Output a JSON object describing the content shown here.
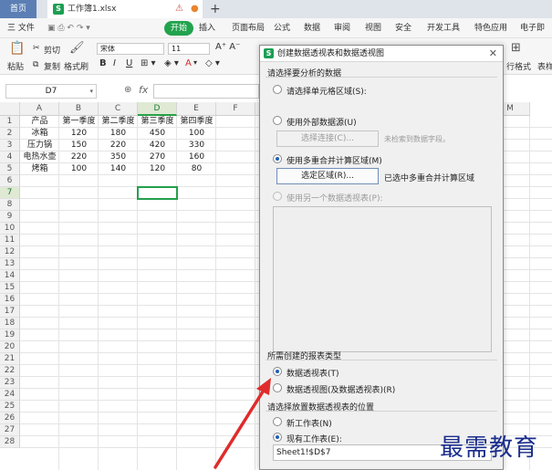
{
  "tabs": {
    "home": "首页",
    "file": "工作簿1.xlsx"
  },
  "menu": [
    "三 文件",
    "开始",
    "插入",
    "页面布局",
    "公式",
    "数据",
    "审阅",
    "视图",
    "安全",
    "开发工具",
    "特色应用",
    "电子即"
  ],
  "toolbar": {
    "cut": "剪切",
    "copy": "复制",
    "paste": "粘贴",
    "format_painter": "格式刷",
    "font": "宋体",
    "size": "11",
    "table_format": "行格式",
    "table_style": "表样"
  },
  "formula": {
    "namebox": "D7",
    "fx": "fx"
  },
  "sheet": {
    "columns": [
      "A",
      "B",
      "C",
      "D",
      "E",
      "F",
      "",
      "",
      "",
      "",
      "",
      "",
      "M"
    ],
    "rows": [
      "1",
      "2",
      "3",
      "4",
      "5",
      "6",
      "7",
      "8",
      "9",
      "10",
      "11",
      "12",
      "13",
      "14",
      "15",
      "16",
      "17",
      "18",
      "19",
      "20",
      "21",
      "22",
      "23",
      "24",
      "25",
      "26",
      "27",
      "28"
    ],
    "cells": [
      [
        "产品",
        "第一季度",
        "第二季度",
        "第三季度",
        "第四季度"
      ],
      [
        "冰箱",
        "120",
        "180",
        "450",
        "100"
      ],
      [
        "压力锅",
        "150",
        "220",
        "420",
        "330"
      ],
      [
        "电热水壶",
        "220",
        "350",
        "270",
        "160"
      ],
      [
        "烤箱",
        "100",
        "140",
        "120",
        "80"
      ]
    ]
  },
  "dialog": {
    "title": "创建数据透视表和数据透视图",
    "section1": "请选择要分析的数据",
    "opt_cell_range": "请选择单元格区域(S):",
    "opt_external": "使用外部数据源(U)",
    "btn_choose_conn": "选择连接(C)...",
    "no_field": "未检索到数据字段。",
    "opt_multi_range": "使用多重合并计算区域(M)",
    "btn_choose_region": "选定区域(R)...",
    "selected_info": "已选中多重合并计算区域",
    "opt_other_pivot": "使用另一个数据透视表(P):",
    "section2": "所需创建的报表类型",
    "opt_pivot_table": "数据透视表(T)",
    "opt_pivot_chart": "数据透视图(及数据透视表)(R)",
    "section3": "请选择放置数据透视表的位置",
    "opt_new_sheet": "新工作表(N)",
    "opt_existing_sheet": "现有工作表(E):",
    "range_value": "Sheet1!$D$7"
  },
  "watermark": "最需教育",
  "colors": {
    "accent": "#22a34d",
    "dialog_bg": "#f0f0f0",
    "arrow": "#e02b2b"
  }
}
